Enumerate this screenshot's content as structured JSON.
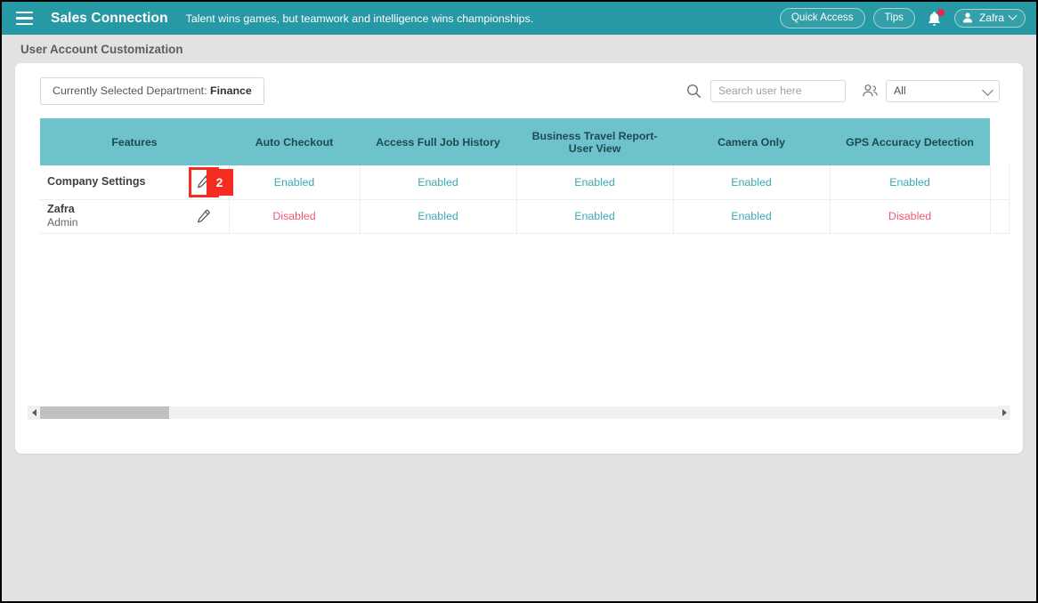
{
  "topbar": {
    "menu_icon": "hamburger-icon",
    "brand": "Sales Connection",
    "tagline": "Talent wins games, but teamwork and intelligence wins championships.",
    "quick_access_label": "Quick Access",
    "tips_label": "Tips",
    "notification_icon": "bell-icon",
    "user_name": "Zafra",
    "user_icon": "person-icon",
    "dropdown_icon": "chevron-down-icon",
    "accent_color": "#2799a4"
  },
  "page": {
    "title": "User Account Customization"
  },
  "toolbar": {
    "department_prefix": "Currently Selected Department: ",
    "department_value": "Finance",
    "search_icon": "search-icon",
    "search_value": "",
    "search_placeholder": "Search user here",
    "group_icon": "people-icon",
    "filter_selected": "All",
    "filter_options": [
      "All"
    ],
    "filter_icon": "chevron-down-icon"
  },
  "table": {
    "header_color": "#6dc2cb",
    "columns": [
      "Features",
      "Auto Checkout",
      "Access Full Job History",
      "Business Travel Report-User View",
      "Camera Only",
      "GPS Accuracy Detection",
      ""
    ],
    "rows": [
      {
        "name": "Company Settings",
        "subtitle": "",
        "edit_icon": "pencil-icon",
        "highlighted": true,
        "values": [
          "Enabled",
          "Enabled",
          "Enabled",
          "Enabled",
          "Enabled",
          ""
        ]
      },
      {
        "name": "Zafra",
        "subtitle": "Admin",
        "edit_icon": "pencil-icon",
        "highlighted": false,
        "values": [
          "Disabled",
          "Enabled",
          "Enabled",
          "Enabled",
          "Disabled",
          ""
        ]
      }
    ],
    "enabled_color": "#3aa9b5",
    "disabled_color": "#f2557a"
  },
  "annotation": {
    "step_number": "2",
    "color": "#f52d21"
  },
  "scrollbar": {
    "left_arrow_icon": "arrow-left-icon",
    "right_arrow_icon": "arrow-right-icon",
    "thumb_position_percent": 0
  }
}
